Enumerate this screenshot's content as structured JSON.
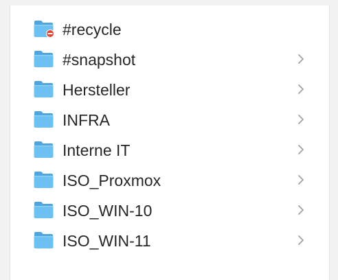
{
  "folders": [
    {
      "name": "#recycle",
      "icon": "folder-restricted-icon",
      "has_children": false
    },
    {
      "name": "#snapshot",
      "icon": "folder-icon",
      "has_children": true
    },
    {
      "name": "Hersteller",
      "icon": "folder-icon",
      "has_children": true
    },
    {
      "name": "INFRA",
      "icon": "folder-icon",
      "has_children": true
    },
    {
      "name": "Interne IT",
      "icon": "folder-icon",
      "has_children": true
    },
    {
      "name": "ISO_Proxmox",
      "icon": "folder-icon",
      "has_children": true
    },
    {
      "name": "ISO_WIN-10",
      "icon": "folder-icon",
      "has_children": true
    },
    {
      "name": "ISO_WIN-11",
      "icon": "folder-icon",
      "has_children": true
    }
  ],
  "colors": {
    "folder_front": "#6cc0f2",
    "folder_back": "#4fa5dc",
    "restricted_badge": "#e0452f",
    "chevron": "#a3a3a3"
  }
}
